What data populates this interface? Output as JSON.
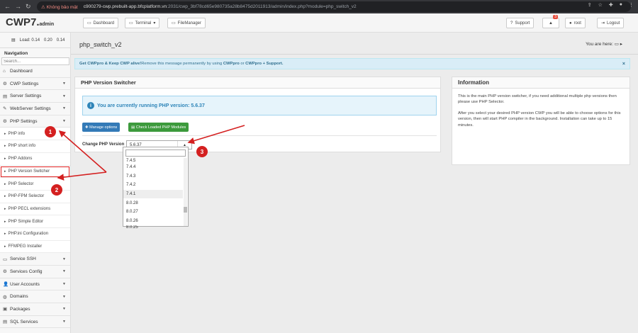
{
  "browser": {
    "nav_back": "←",
    "nav_forward": "→",
    "nav_reload": "↻",
    "warning": "⚠ Không bảo mật",
    "url_host": "c900279-cwp.prebuilt-app.bfcplatform.vn",
    "url_rest": ":2031/cwp_3bf78cd65e980735a28b8475d2011913/admin/index.php?module=php_switch_v2"
  },
  "topbar": {
    "logo": "CWP7.",
    "logo_suffix": "admin",
    "dashboard": "Dashboard",
    "terminal": "Terminal",
    "filemanager": "FileManager",
    "support": "Support",
    "notify_count": "3",
    "user": "root",
    "logout": "Logout"
  },
  "sidebar": {
    "load": [
      "Load: 0.14",
      "0.20",
      "0.14"
    ],
    "nav_title": "Navigation",
    "search_placeholder": "Search...",
    "items_top": [
      {
        "label": "Dashboard",
        "icon": "home-icon"
      },
      {
        "label": "CWP Settings",
        "icon": "settings-icon"
      },
      {
        "label": "Server Settings",
        "icon": "server-icon"
      },
      {
        "label": "WebServer Settings",
        "icon": "webserver-icon"
      },
      {
        "label": "PHP Settings",
        "icon": "gear-icon"
      }
    ],
    "sub_items": [
      "PHP info",
      "PHP short info",
      "PHP Addons",
      "PHP Version Switcher",
      "PHP Selector",
      "PHP-FPM Selector",
      "PHP PECL extensions",
      "PHP Simple Editor",
      "PHP.ini Configuration",
      "FFMPEG Installer"
    ],
    "items_bottom": [
      "Service SSH",
      "Services Config",
      "User Accounts",
      "Domains",
      "Packages",
      "SQL Services"
    ]
  },
  "main": {
    "page_title": "php_switch_v2",
    "you_are_here": "You are here:",
    "notice_bold1": "Get CWPpro & Keep CWP alive!",
    "notice_text1": " Remove this message permanently by using ",
    "notice_bold2": "CWPpro",
    "notice_text2": " or ",
    "notice_bold3": "CWPpro + Support.",
    "notice_close": "×",
    "switcher": {
      "title": "PHP Version Switcher",
      "running_text": "You are currently running PHP version: 5.6.37",
      "btn_manage": "Manage options",
      "btn_check": "Check Loaded PHP Modules",
      "change_label": "Change PHP Version",
      "selected": "5.6.37",
      "options": [
        "7.4.5",
        "7.4.4",
        "7.4.3",
        "7.4.2",
        "7.4.1",
        "8.0.28",
        "8.0.27",
        "8.0.26",
        "8.0.25"
      ],
      "highlighted_index": 4
    },
    "information": {
      "title": "Information",
      "p1": "This is the main PHP version switcher, if you need additional multiple php versions then please use PHP Selector.",
      "p2": "After you select your desired PHP version CWP you will be able to choose options for this version, then will start PHP compiler in the background. Installation can take up to 15 minutes."
    }
  },
  "annotations": {
    "n1": "1",
    "n2": "2",
    "n3": "3",
    "color": "#d42020"
  }
}
